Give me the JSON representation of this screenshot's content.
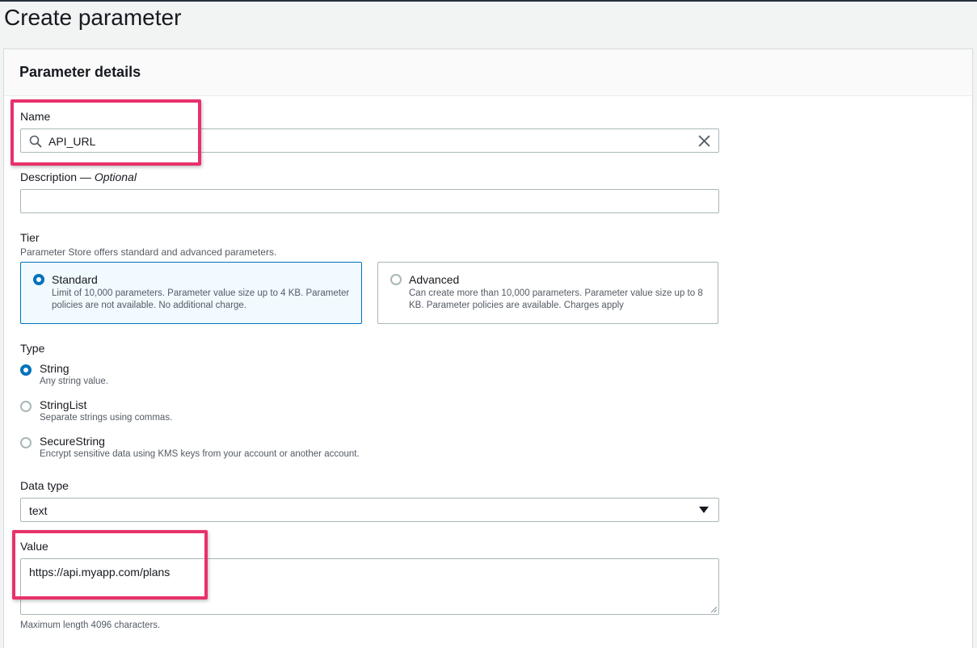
{
  "page": {
    "title": "Create parameter"
  },
  "panel": {
    "title": "Parameter details"
  },
  "name_field": {
    "label": "Name",
    "value": "API_URL"
  },
  "description_field": {
    "label": "Description",
    "optional": "Optional",
    "value": ""
  },
  "tier": {
    "label": "Tier",
    "hint": "Parameter Store offers standard and advanced parameters.",
    "options": [
      {
        "name": "Standard",
        "description": "Limit of 10,000 parameters. Parameter value size up to 4 KB. Parameter policies are not available. No additional charge.",
        "selected": true
      },
      {
        "name": "Advanced",
        "description": "Can create more than 10,000 parameters. Parameter value size up to 8 KB. Parameter policies are available. Charges apply",
        "selected": false
      }
    ]
  },
  "type": {
    "label": "Type",
    "options": [
      {
        "name": "String",
        "description": "Any string value.",
        "selected": true
      },
      {
        "name": "StringList",
        "description": "Separate strings using commas.",
        "selected": false
      },
      {
        "name": "SecureString",
        "description": "Encrypt sensitive data using KMS keys from your account or another account.",
        "selected": false
      }
    ]
  },
  "data_type": {
    "label": "Data type",
    "value": "text"
  },
  "value_field": {
    "label": "Value",
    "value": "https://api.myapp.com/plans",
    "hint": "Maximum length 4096 characters."
  },
  "colors": {
    "accent": "#0073bb",
    "highlight": "#e8316b",
    "selected_tile_bg": "#f1faff"
  },
  "icons": {
    "search": "search-icon",
    "clear": "close-icon",
    "caret": "caret-down-icon",
    "resize": "resize-grip-icon"
  }
}
